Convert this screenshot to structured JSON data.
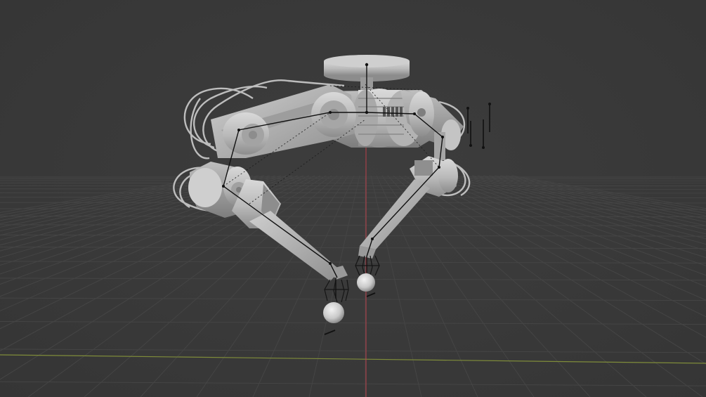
{
  "viewport": {
    "mode": "solid",
    "background_color": "#393939",
    "grid_color": "#454545",
    "x_axis_color": "#8b9a3a",
    "z_axis_color": "#c8434f",
    "mesh_color": "#bdbdbd",
    "rig_line_color": "#111111"
  },
  "scene": {
    "object": "robot-arm-rig",
    "arm_count": 2,
    "gripper_count": 2
  }
}
